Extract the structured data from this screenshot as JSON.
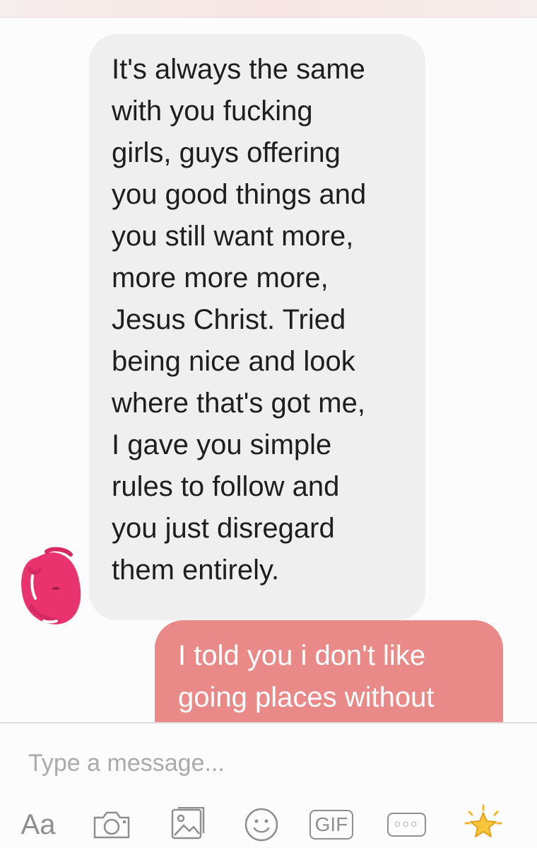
{
  "thread": {
    "incoming_message": "It's always the same\nwith you fucking\ngirls, guys offering\nyou good things and\nyou still want more,\nmore more more,\nJesus Christ. Tried\nbeing nice and look\nwhere that's got me,\nI gave you simple\nrules to follow and\nyou just disregard\nthem entirely.",
    "outgoing_message": "I told you i don't like\ngoing places without"
  },
  "composer": {
    "placeholder": "Type a message...",
    "toolbar": {
      "text_label": "Aa",
      "gif_label": "GIF",
      "more_label": "○○○"
    }
  },
  "colors": {
    "incoming_bubble": "#efefef",
    "outgoing_bubble": "#ea8a88",
    "avatar_scribble": "#e8336e",
    "toolbar_icon": "#8f8f8f",
    "star_icon": "#f3b62b"
  }
}
